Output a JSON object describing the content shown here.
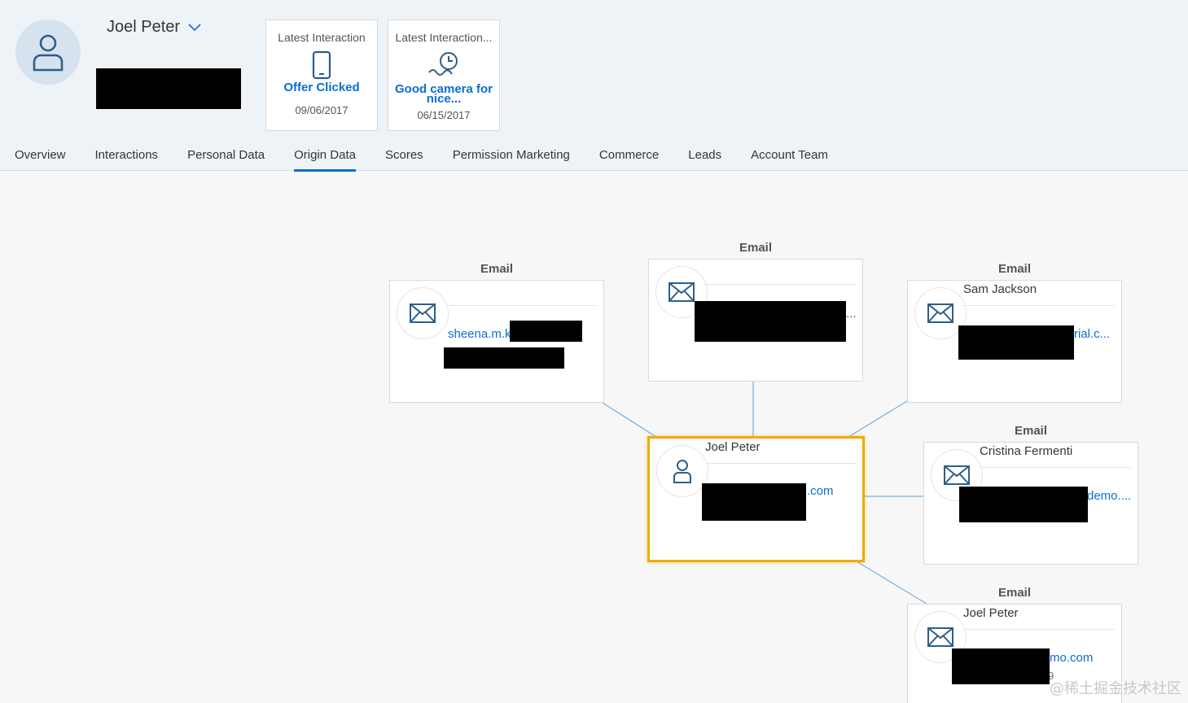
{
  "header": {
    "name": "Joel Peter",
    "avatar_icon": "person-icon",
    "dropdown_icon": "chevron-down-icon"
  },
  "tiles": [
    {
      "heading": "Latest Interaction",
      "icon": "mobile-phone-icon",
      "value": "Offer Clicked",
      "date": "09/06/2017"
    },
    {
      "heading": "Latest Interaction...",
      "icon": "clock-trend-icon",
      "value": "Good camera for nice...",
      "date": "06/15/2017"
    }
  ],
  "tabs": [
    {
      "label": "Overview"
    },
    {
      "label": "Interactions"
    },
    {
      "label": "Personal Data"
    },
    {
      "label": "Origin Data",
      "active": true
    },
    {
      "label": "Scores"
    },
    {
      "label": "Permission Marketing"
    },
    {
      "label": "Commerce"
    },
    {
      "label": "Leads"
    },
    {
      "label": "Account Team"
    }
  ],
  "graph": {
    "center": {
      "title": "Joel Peter",
      "email_suffix": ".com",
      "icon": "person-icon"
    },
    "nodes": [
      {
        "label": "Email",
        "title": "",
        "link": "sheena.m.k",
        "icon": "envelope-icon"
      },
      {
        "label": "Email",
        "title": "",
        "link": "...",
        "icon": "envelope-icon"
      },
      {
        "label": "Email",
        "title": "Sam Jackson",
        "link": "rial.c...",
        "icon": "envelope-icon"
      },
      {
        "label": "Email",
        "title": "Cristina Fermenti",
        "link": "demo....",
        "icon": "envelope-icon"
      },
      {
        "label": "Email",
        "title": "Joel Peter",
        "link": "mo.com",
        "extra": "9",
        "icon": "envelope-icon"
      }
    ]
  },
  "colors": {
    "accent": "#0a6ed1",
    "selected_border": "#f0ab00",
    "header_bg": "#eef3f8"
  },
  "watermark": "@稀土掘金技术社区"
}
